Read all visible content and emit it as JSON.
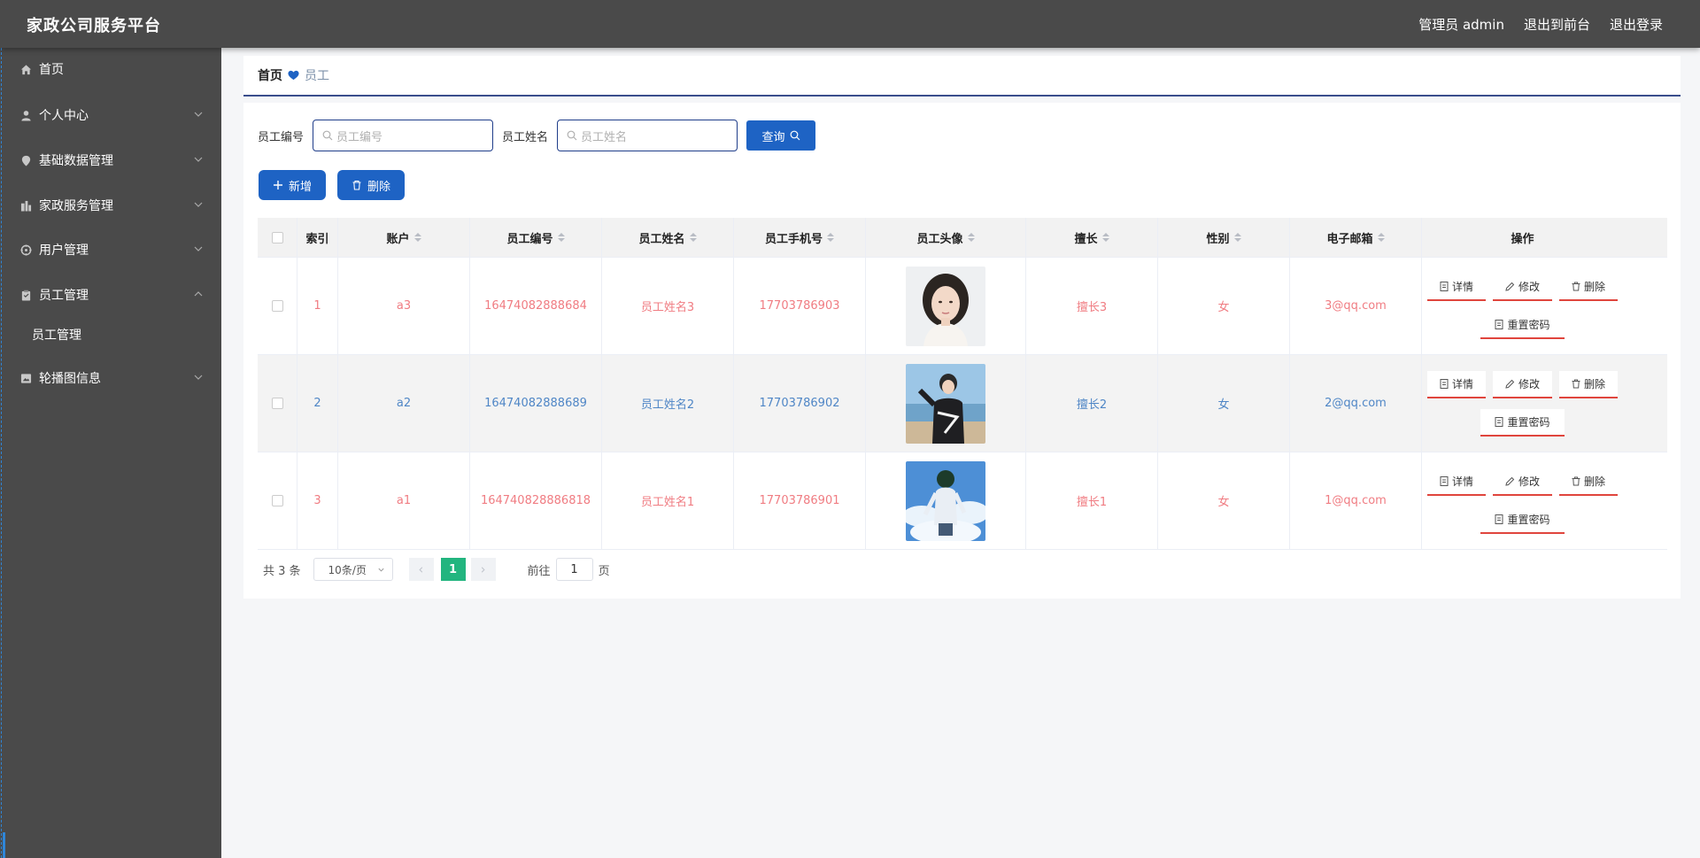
{
  "header": {
    "title": "家政公司服务平台",
    "links": [
      "管理员 admin",
      "退出到前台",
      "退出登录"
    ]
  },
  "sidebar": {
    "items": [
      {
        "label": "首页",
        "icon": "home-icon"
      },
      {
        "label": "个人中心",
        "icon": "user-icon",
        "expandable": true
      },
      {
        "label": "基础数据管理",
        "icon": "location-pin-icon",
        "expandable": true
      },
      {
        "label": "家政服务管理",
        "icon": "building-icon",
        "expandable": true
      },
      {
        "label": "用户管理",
        "icon": "compass-icon",
        "expandable": true
      },
      {
        "label": "员工管理",
        "icon": "clipboard-icon",
        "expandable": true,
        "expanded": true
      },
      {
        "label": "轮播图信息",
        "icon": "picture-icon",
        "expandable": true
      }
    ],
    "sub_items": [
      "员工管理"
    ]
  },
  "breadcrumb": {
    "home": "首页",
    "current": "员工"
  },
  "search": {
    "fields": [
      {
        "label": "员工编号",
        "placeholder": "员工编号"
      },
      {
        "label": "员工姓名",
        "placeholder": "员工姓名"
      }
    ],
    "query_label": "查询"
  },
  "actions": {
    "add_label": "新增",
    "delete_label": "删除"
  },
  "table": {
    "headers": [
      "索引",
      "账户",
      "员工编号",
      "员工姓名",
      "员工手机号",
      "员工头像",
      "擅长",
      "性别",
      "电子邮箱",
      "操作"
    ],
    "rows": [
      {
        "index": "1",
        "account": "a3",
        "emp_no": "16474082888684",
        "name": "员工姓名3",
        "phone": "17703786903",
        "skill": "擅长3",
        "gender": "女",
        "email": "3@qq.com",
        "color": "#f07c82",
        "avatar": "avatar-woman"
      },
      {
        "index": "2",
        "account": "a2",
        "emp_no": "16474082888689",
        "name": "员工姓名2",
        "phone": "17703786902",
        "skill": "擅长2",
        "gender": "女",
        "email": "2@qq.com",
        "color": "#4f86c6",
        "avatar": "avatar-boy-beach"
      },
      {
        "index": "3",
        "account": "a1",
        "emp_no": "164740828886818",
        "name": "员工姓名1",
        "phone": "17703786901",
        "skill": "擅长1",
        "gender": "女",
        "email": "1@qq.com",
        "color": "#f07c82",
        "avatar": "avatar-boy-sky"
      }
    ],
    "row_ops": [
      "详情",
      "修改",
      "删除",
      "重置密码"
    ]
  },
  "pagination": {
    "total": "共 3 条",
    "page_size": "10条/页",
    "current": "1",
    "goto_prefix": "前往",
    "goto_value": "1",
    "goto_suffix": "页"
  },
  "colors": {
    "accent": "#1e63c4",
    "sidebar": "#4a4a4a",
    "pager_active": "#22b57f",
    "op_underline": "#e0453d"
  }
}
